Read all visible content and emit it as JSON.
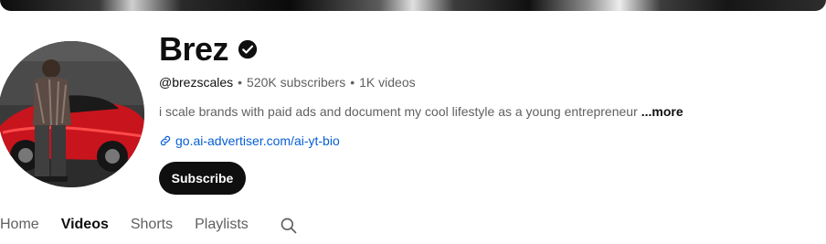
{
  "channel": {
    "name": "Brez",
    "handle": "@brezscales",
    "subscribers": "520K subscribers",
    "videos": "1K videos",
    "separator": "•",
    "description": "i scale brands with paid ads and document my cool lifestyle as a young entrepreneur",
    "more_label": "...more",
    "link": "go.ai-advertiser.com/ai-yt-bio",
    "subscribe_label": "Subscribe",
    "verified_icon": "verified-check-icon",
    "link_icon": "link-icon"
  },
  "tabs": [
    {
      "label": "Home"
    },
    {
      "label": "Videos",
      "active": true
    },
    {
      "label": "Shorts"
    },
    {
      "label": "Playlists"
    }
  ],
  "colors": {
    "link": "#065fd4",
    "button_bg": "#0f0f0f",
    "secondary_text": "#606060"
  }
}
